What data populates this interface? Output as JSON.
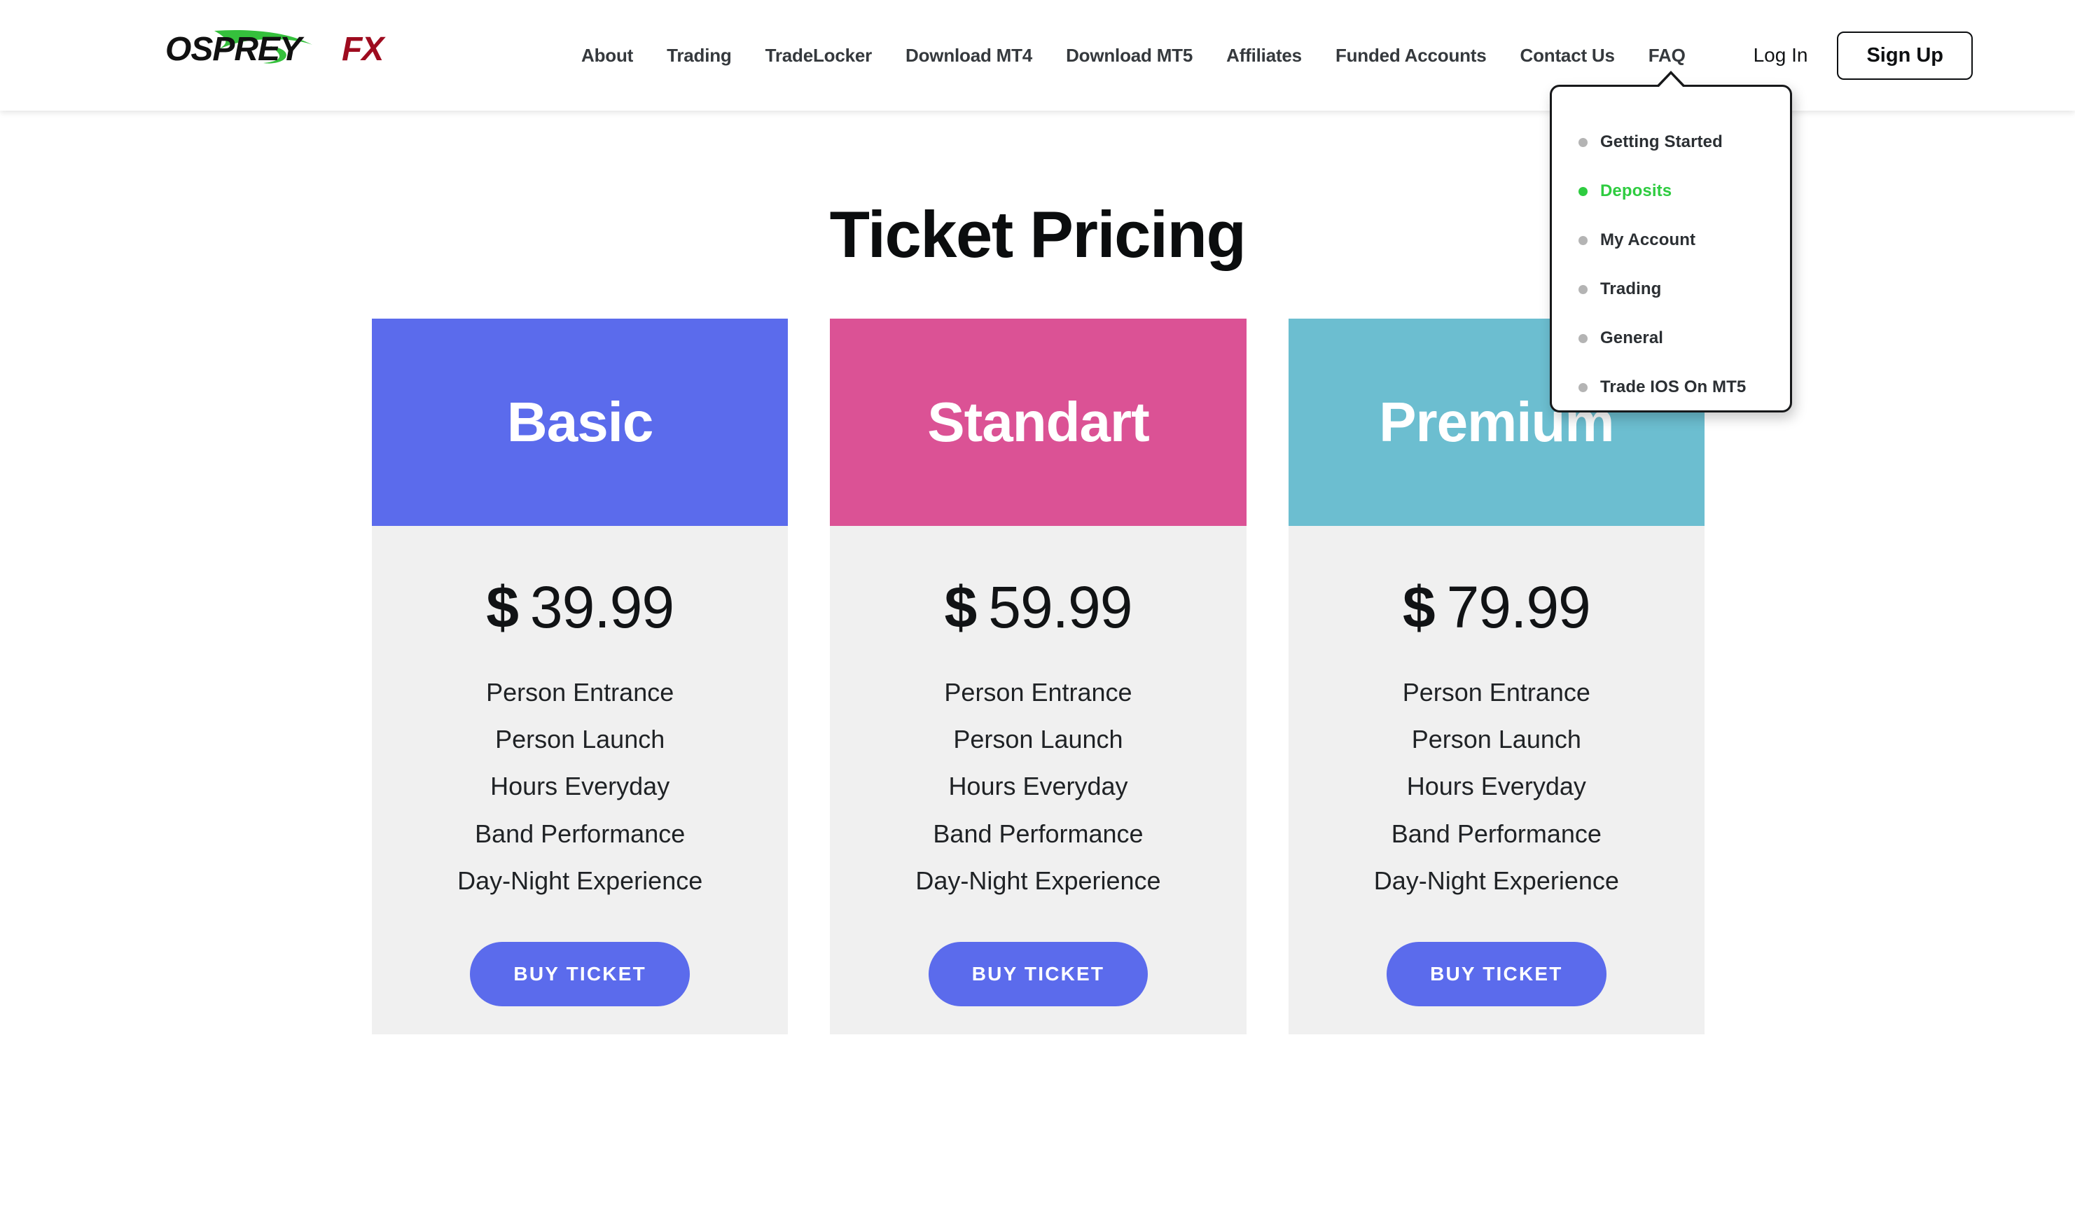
{
  "header": {
    "logo": {
      "name": "OspreyFX",
      "text_primary": "OSPREY",
      "text_accent": "FX",
      "color_primary": "#111111",
      "color_accent": "#9e0b1f",
      "color_swoosh": "#35c03c"
    },
    "nav_items": [
      {
        "label": "About"
      },
      {
        "label": "Trading"
      },
      {
        "label": "TradeLocker"
      },
      {
        "label": "Download MT4"
      },
      {
        "label": "Download MT5"
      },
      {
        "label": "Affiliates"
      },
      {
        "label": "Funded Accounts"
      },
      {
        "label": "Contact Us"
      },
      {
        "label": "FAQ"
      }
    ],
    "login_label": "Log In",
    "signup_label": "Sign Up"
  },
  "faq_dropdown": {
    "items": [
      {
        "label": "Getting Started",
        "active": false
      },
      {
        "label": "Deposits",
        "active": true
      },
      {
        "label": "My Account",
        "active": false
      },
      {
        "label": "Trading",
        "active": false
      },
      {
        "label": "General",
        "active": false
      },
      {
        "label": "Trade IOS On MT5",
        "active": false
      }
    ],
    "active_color": "#2ecc40",
    "bullet_color": "#b4b4b4"
  },
  "main": {
    "title": "Ticket Pricing",
    "buy_button_label": "BUY TICKET",
    "cards": [
      {
        "name": "Basic",
        "header_color": "#5b6bec",
        "currency": "$",
        "amount": "39.99",
        "features": [
          "Person Entrance",
          "Person Launch",
          "Hours Everyday",
          "Band Performance",
          "Day-Night Experience"
        ],
        "button_label": "BUY TICKET",
        "button_color": "#5b6bec"
      },
      {
        "name": "Standart",
        "header_color": "#db5295",
        "currency": "$",
        "amount": "59.99",
        "features": [
          "Person Entrance",
          "Person Launch",
          "Hours Everyday",
          "Band Performance",
          "Day-Night Experience"
        ],
        "button_label": "BUY TICKET",
        "button_color": "#5b6bec"
      },
      {
        "name": "Premium",
        "header_color": "#6cbed0",
        "currency": "$",
        "amount": "79.99",
        "features": [
          "Person Entrance",
          "Person Launch",
          "Hours Everyday",
          "Band Performance",
          "Day-Night Experience"
        ],
        "button_label": "BUY TICKET",
        "button_color": "#5b6bec"
      }
    ]
  }
}
